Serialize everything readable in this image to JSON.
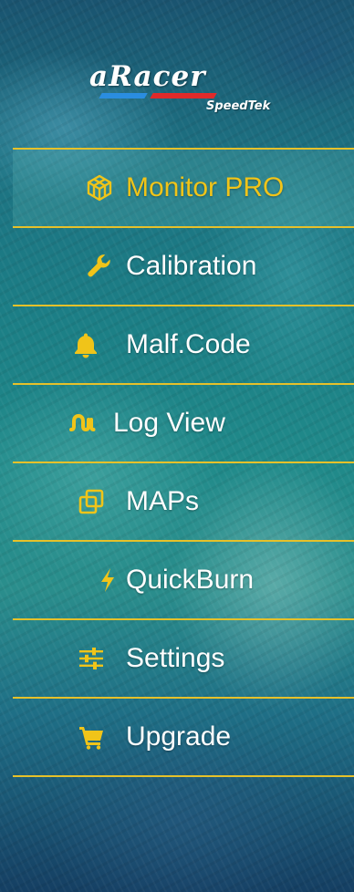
{
  "colors": {
    "accent": "#f0c419",
    "divider": "#e6c12a",
    "text": "#ffffff",
    "logo_blue": "#2a8de0",
    "logo_red": "#e02a2a"
  },
  "logo": {
    "brand": "aRacer",
    "sub": "SpeedTek"
  },
  "menu": {
    "active": "monitor-pro",
    "items": [
      {
        "id": "monitor-pro",
        "label": "Monitor PRO",
        "icon": "cube-icon"
      },
      {
        "id": "calibration",
        "label": "Calibration",
        "icon": "wrench-icon"
      },
      {
        "id": "malf-code",
        "label": "Malf.Code",
        "icon": "bell-icon"
      },
      {
        "id": "log-view",
        "label": "Log View",
        "icon": "wave-icon"
      },
      {
        "id": "maps",
        "label": "MAPs",
        "icon": "copy-icon"
      },
      {
        "id": "quickburn",
        "label": "QuickBurn",
        "icon": "bolt-icon"
      },
      {
        "id": "settings",
        "label": "Settings",
        "icon": "sliders-icon"
      },
      {
        "id": "upgrade",
        "label": "Upgrade",
        "icon": "cart-icon"
      }
    ]
  }
}
